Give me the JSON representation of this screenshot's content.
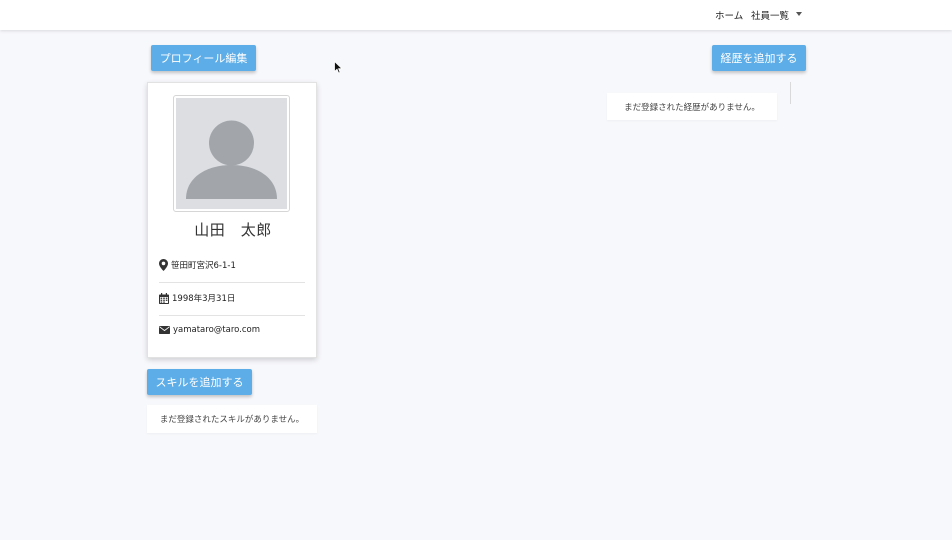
{
  "navbar": {
    "home": "ホーム",
    "employees": "社員一覧"
  },
  "buttons": {
    "edit_profile": "プロフィール編集",
    "add_career": "経歴を追加する",
    "add_skill": "スキルを追加する"
  },
  "profile": {
    "name": "山田　太郎",
    "address": "笹田町宮沢6-1-1",
    "birthday": "1998年3月31日",
    "email": "yamataro@taro.com"
  },
  "career": {
    "empty_message": "まだ登録された経歴がありません。"
  },
  "skills": {
    "empty_message": "まだ登録されたスキルがありません。"
  },
  "icons": [
    "map-marker-icon",
    "calendar-icon",
    "envelope-icon",
    "caret-down-icon",
    "avatar-placeholder-icon"
  ],
  "colors": {
    "button": "#5dade8",
    "background": "#f7f8fb",
    "navbar": "#ffffff"
  }
}
